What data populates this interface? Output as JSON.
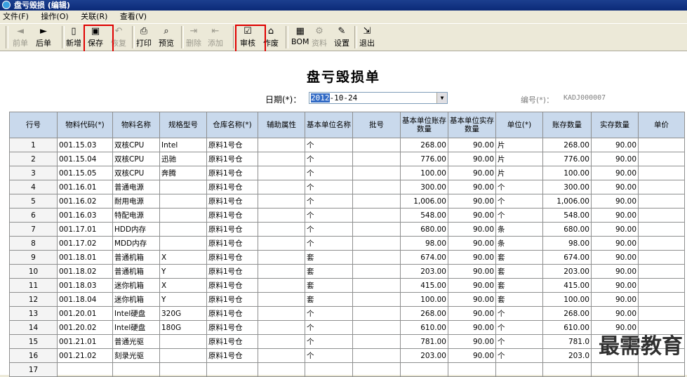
{
  "window": {
    "title": "盘亏毁损 (编辑)"
  },
  "menu": [
    "文件(F)",
    "操作(O)",
    "关联(R)",
    "查看(V)"
  ],
  "toolbar": [
    {
      "label": "前单",
      "icon": "◄",
      "disabled": true
    },
    {
      "label": "后单",
      "icon": "►",
      "disabled": false
    },
    {
      "label": "新增",
      "icon": "▯",
      "disabled": false
    },
    {
      "label": "保存",
      "icon": "▣",
      "disabled": false
    },
    {
      "label": "恢复",
      "icon": "↶",
      "disabled": true
    },
    {
      "label": "打印",
      "icon": "⎙",
      "disabled": false
    },
    {
      "label": "预览",
      "icon": "⌕",
      "disabled": false
    },
    {
      "label": "删除",
      "icon": "⇥",
      "disabled": true
    },
    {
      "label": "添加",
      "icon": "⇤",
      "disabled": true
    },
    {
      "label": "审核",
      "icon": "☑",
      "disabled": false
    },
    {
      "label": "作废",
      "icon": "⌂",
      "disabled": false
    },
    {
      "label": "BOM",
      "icon": "▦",
      "disabled": false
    },
    {
      "label": "资料",
      "icon": "⚙",
      "disabled": true
    },
    {
      "label": "设置",
      "icon": "✎",
      "disabled": false
    },
    {
      "label": "退出",
      "icon": "⇲",
      "disabled": false
    }
  ],
  "form": {
    "title": "盘亏毁损单",
    "date_label": "日期(*)：",
    "date_highlight": "2012",
    "date_rest": "-10-24",
    "number_label": "编号(*)：",
    "number_value": "KADJ000007"
  },
  "table": {
    "headers": [
      "行号",
      "物料代码(*)",
      "物料名称",
      "规格型号",
      "仓库名称(*)",
      "辅助属性",
      "基本单位名称",
      "批号",
      "基本单位账存数量",
      "基本单位实存数量",
      "单位(*)",
      "账存数量",
      "实存数量",
      "单价"
    ],
    "rows": [
      [
        "1",
        "001.15.03",
        "双核CPU",
        "Intel",
        "原料1号仓",
        "",
        "个",
        "",
        "268.00",
        "90.00",
        "片",
        "268.00",
        "90.00",
        ""
      ],
      [
        "2",
        "001.15.04",
        "双核CPU",
        "迅驰",
        "原料1号仓",
        "",
        "个",
        "",
        "776.00",
        "90.00",
        "片",
        "776.00",
        "90.00",
        ""
      ],
      [
        "3",
        "001.15.05",
        "双核CPU",
        "奔腾",
        "原料1号仓",
        "",
        "个",
        "",
        "100.00",
        "90.00",
        "片",
        "100.00",
        "90.00",
        ""
      ],
      [
        "4",
        "001.16.01",
        "普通电源",
        "",
        "原料1号仓",
        "",
        "个",
        "",
        "300.00",
        "90.00",
        "个",
        "300.00",
        "90.00",
        ""
      ],
      [
        "5",
        "001.16.02",
        "耐用电源",
        "",
        "原料1号仓",
        "",
        "个",
        "",
        "1,006.00",
        "90.00",
        "个",
        "1,006.00",
        "90.00",
        ""
      ],
      [
        "6",
        "001.16.03",
        "特配电源",
        "",
        "原料1号仓",
        "",
        "个",
        "",
        "548.00",
        "90.00",
        "个",
        "548.00",
        "90.00",
        ""
      ],
      [
        "7",
        "001.17.01",
        "HDD内存",
        "",
        "原料1号仓",
        "",
        "个",
        "",
        "680.00",
        "90.00",
        "条",
        "680.00",
        "90.00",
        ""
      ],
      [
        "8",
        "001.17.02",
        "MDD内存",
        "",
        "原料1号仓",
        "",
        "个",
        "",
        "98.00",
        "90.00",
        "条",
        "98.00",
        "90.00",
        ""
      ],
      [
        "9",
        "001.18.01",
        "普通机箱",
        "X",
        "原料1号仓",
        "",
        "套",
        "",
        "674.00",
        "90.00",
        "套",
        "674.00",
        "90.00",
        ""
      ],
      [
        "10",
        "001.18.02",
        "普通机箱",
        "Y",
        "原料1号仓",
        "",
        "套",
        "",
        "203.00",
        "90.00",
        "套",
        "203.00",
        "90.00",
        ""
      ],
      [
        "11",
        "001.18.03",
        "迷你机箱",
        "X",
        "原料1号仓",
        "",
        "套",
        "",
        "415.00",
        "90.00",
        "套",
        "415.00",
        "90.00",
        ""
      ],
      [
        "12",
        "001.18.04",
        "迷你机箱",
        "Y",
        "原料1号仓",
        "",
        "套",
        "",
        "100.00",
        "90.00",
        "套",
        "100.00",
        "90.00",
        ""
      ],
      [
        "13",
        "001.20.01",
        "Intel硬盘",
        "320G",
        "原料1号仓",
        "",
        "个",
        "",
        "268.00",
        "90.00",
        "个",
        "268.00",
        "90.00",
        ""
      ],
      [
        "14",
        "001.20.02",
        "Intel硬盘",
        "180G",
        "原料1号仓",
        "",
        "个",
        "",
        "610.00",
        "90.00",
        "个",
        "610.00",
        "90.00",
        ""
      ],
      [
        "15",
        "001.21.01",
        "普通光驱",
        "",
        "原料1号仓",
        "",
        "个",
        "",
        "781.00",
        "90.00",
        "个",
        "781.0",
        "",
        ""
      ],
      [
        "16",
        "001.21.02",
        "刻录光驱",
        "",
        "原料1号仓",
        "",
        "个",
        "",
        "203.00",
        "90.00",
        "个",
        "203.0",
        "",
        ""
      ],
      [
        "17",
        "",
        "",
        "",
        "",
        "",
        "",
        "",
        "",
        "",
        "",
        "",
        "",
        ""
      ]
    ]
  },
  "watermark": "最需教育"
}
